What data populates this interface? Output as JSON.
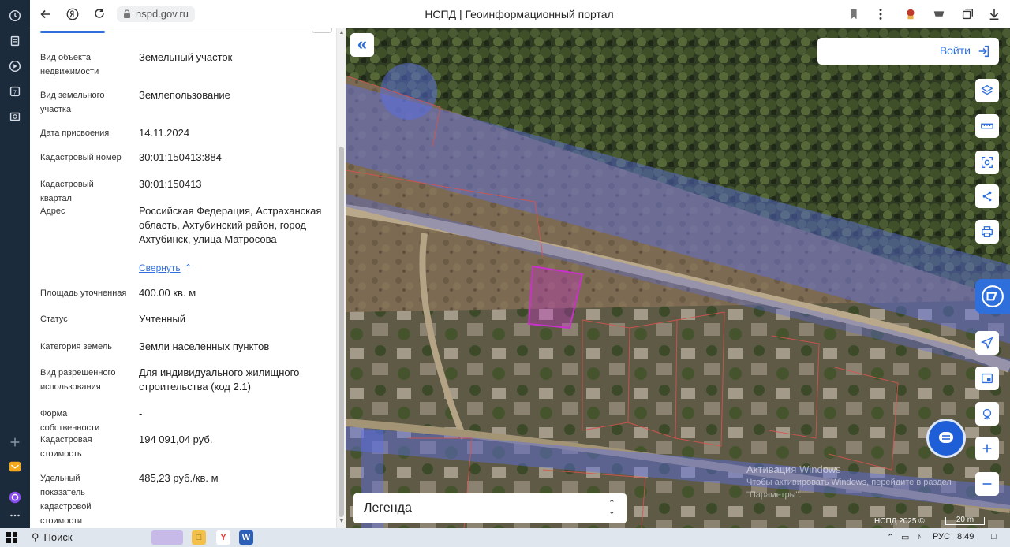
{
  "browser": {
    "url": "nspd.gov.ru",
    "title": "НСПД | Геоинформационный портал"
  },
  "panel": {
    "rows": [
      {
        "label": "Вид объекта недвижимости",
        "value": "Земельный участок"
      },
      {
        "label": "Вид земельного участка",
        "value": "Землепользование"
      },
      {
        "label": "Дата присвоения",
        "value": "14.11.2024"
      },
      {
        "label": "Кадастровый номер",
        "value": "30:01:150413:884"
      },
      {
        "label": "Кадастровый квартал",
        "value": "30:01:150413"
      },
      {
        "label": "Адрес",
        "value": "Российская Федерация, Астраханская область, Ахтубинский район, город Ахтубинск, улица Матросова"
      },
      {
        "label": "Площадь уточненная",
        "value": "400.00 кв. м"
      },
      {
        "label": "Статус",
        "value": "Учтенный"
      },
      {
        "label": "Категория земель",
        "value": "Земли населенных пунктов"
      },
      {
        "label": "Вид разрешенного использования",
        "value": "Для индивидуального жилищного строительства (код 2.1)"
      },
      {
        "label": "Форма собственности",
        "value": "-"
      },
      {
        "label": "Кадастровая стоимость",
        "value": "194 091,04 руб."
      },
      {
        "label": "Удельный показатель кадастровой стоимости",
        "value": "485,23 руб./кв. м"
      }
    ],
    "collapse_link": "Свернуть"
  },
  "map": {
    "login_label": "Войти",
    "legend_label": "Легенда",
    "watermark_line1": "Активация Windows",
    "watermark_line2": "Чтобы активировать Windows, перейдите в раздел \"Параметры\".",
    "copyright": "НСПД 2025 ©",
    "scale_label": "20 m",
    "tools": [
      "layers-icon",
      "ruler-icon",
      "select-area-icon",
      "share-icon",
      "print-icon",
      "locate-icon",
      "minimap-icon",
      "geo-target-icon",
      "zoom-in-icon",
      "zoom-out-icon"
    ]
  },
  "taskbar": {
    "search_label": "Поиск",
    "lang": "РУС",
    "time": "8:49"
  },
  "colors": {
    "accent": "#2f6fdc",
    "parcel": "#c832c8",
    "zone": "#5a6ee6"
  }
}
